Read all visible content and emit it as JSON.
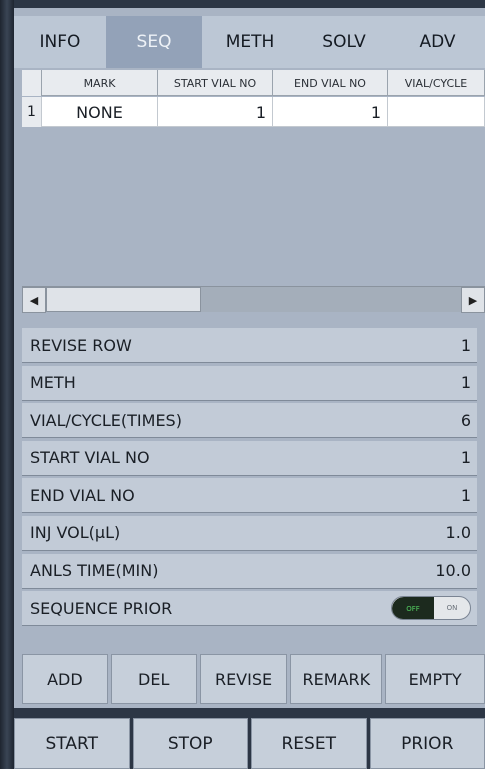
{
  "tabs": [
    "INFO",
    "SEQ",
    "METH",
    "SOLV",
    "ADV"
  ],
  "active_tab": "SEQ",
  "table": {
    "headers": [
      "",
      "MARK",
      "START VIAL NO",
      "END VIAL NO",
      "VIAL/CYCLE"
    ],
    "rows": [
      {
        "num": "1",
        "mark": "NONE",
        "start": "1",
        "end": "1",
        "vial": ""
      }
    ],
    "scroll_left_glyph": "◀",
    "scroll_right_glyph": "▶"
  },
  "params": [
    {
      "label": "REVISE ROW",
      "value": "1"
    },
    {
      "label": "METH",
      "value": "1"
    },
    {
      "label": "VIAL/CYCLE(TIMES)",
      "value": "6"
    },
    {
      "label": "START VIAL NO",
      "value": "1"
    },
    {
      "label": "END VIAL NO",
      "value": "1"
    },
    {
      "label": "INJ VOL(μL)",
      "value": "1.0"
    },
    {
      "label": "ANLS TIME(MIN)",
      "value": "10.0"
    }
  ],
  "sequence_prior": {
    "label": "SEQUENCE PRIOR",
    "off_text": "OFF",
    "on_text": "ON",
    "state": "off"
  },
  "actions": [
    "ADD",
    "DEL",
    "REVISE",
    "REMARK",
    "EMPTY"
  ],
  "bottom": [
    "START",
    "STOP",
    "RESET",
    "PRIOR"
  ],
  "colors": {
    "panel": "#a9b4c4",
    "active_tab": "#93a2b8",
    "toggle_off_bg": "#1c2a1e",
    "toggle_off_text": "#54d062"
  }
}
